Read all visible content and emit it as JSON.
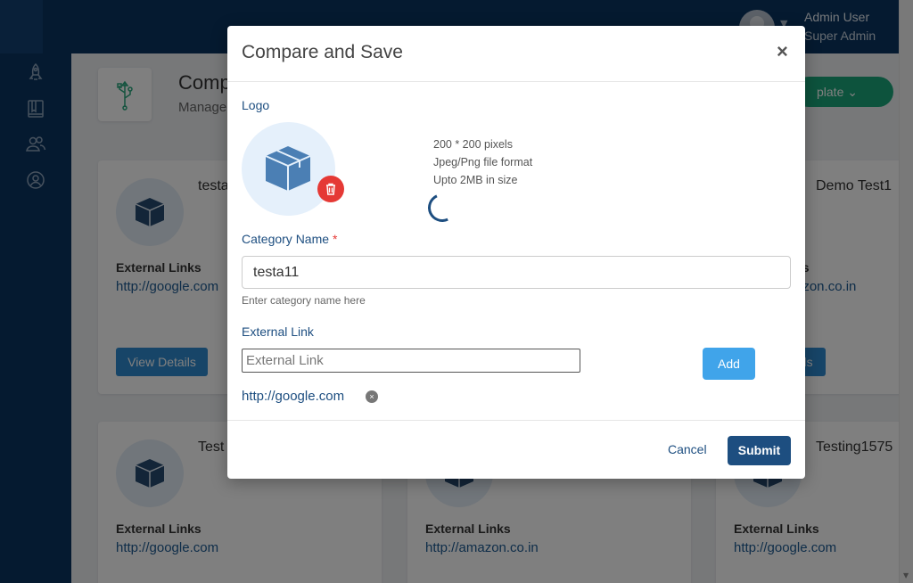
{
  "header": {
    "user_name": "Admin User",
    "user_role": "Super Admin"
  },
  "sidebar": {
    "icons": [
      "rocket-icon",
      "book-icon",
      "users-icon",
      "support-icon"
    ]
  },
  "page": {
    "title": "Comp",
    "subtitle": "Manage",
    "template_button": "plate"
  },
  "cards": [
    {
      "name": "testa",
      "links_label": "External Links",
      "link": "http://google.com",
      "button": "View Details"
    },
    {
      "name": "Demo Test1",
      "links_label": "ks",
      "link": "azon.co.in",
      "button": "ils"
    },
    {
      "name": "Test",
      "links_label": "External Links",
      "link": "http://google.com"
    },
    {
      "name": "",
      "links_label": "External Links",
      "link": "http://amazon.co.in"
    },
    {
      "name": "Testing1575",
      "links_label": "External Links",
      "link": "http://google.com"
    }
  ],
  "modal": {
    "title": "Compare and Save",
    "close": "×",
    "logo_label": "Logo",
    "hints": [
      "200 * 200 pixels",
      "Jpeg/Png file format",
      "Upto 2MB in size"
    ],
    "category_label": "Category Name",
    "required_mark": "*",
    "category_value": "testa11",
    "category_helper": "Enter category name here",
    "external_link_label": "External Link",
    "external_link_placeholder": "External Link",
    "add_button": "Add",
    "links": [
      "http://google.com"
    ],
    "chip_remove": "×",
    "cancel": "Cancel",
    "submit": "Submit"
  },
  "colors": {
    "primary": "#1d4e80",
    "accent": "#40a4ea",
    "danger": "#e53935",
    "topbar": "#0b3561"
  }
}
